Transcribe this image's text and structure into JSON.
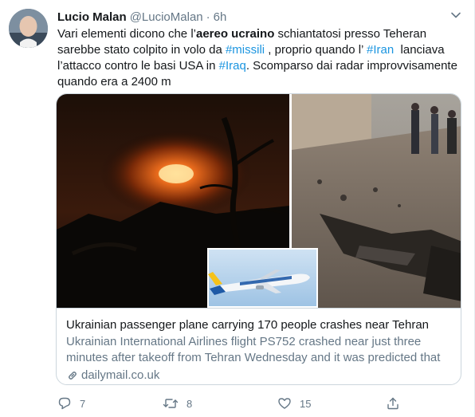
{
  "tweet": {
    "author_name": "Lucio Malan",
    "author_handle": "@LucioMalan",
    "separator": "·",
    "time": "6h",
    "text": {
      "l1_a": "Vari elementi dicono che l’",
      "l1_b": "aereo ucraino",
      "l1_c": " schiantatosi presso Teheran",
      "l2_a": "sarebbe stato colpito in volo da ",
      "l2_b": "#missili",
      "l2_c": " , proprio quando l’ ",
      "l2_d": "#Iran",
      "l2_e": "  lanciava",
      "l3_a": "l’attacco contro le basi USA in ",
      "l3_b": "#Iraq",
      "l3_c": ". Scomparso dai radar improvvisamente",
      "l4": "quando era a 2400 m"
    }
  },
  "card": {
    "title": "Ukrainian passenger plane carrying 170 people crashes near Tehran",
    "description": "Ukrainian International Airlines flight PS752 crashed near just three minutes after takeoff from Tehran Wednesday and it was predicted that ...",
    "domain": "dailymail.co.uk"
  },
  "actions": {
    "reply_count": "7",
    "retweet_count": "8",
    "like_count": "15"
  },
  "icons": {
    "caret": "chevron-down-icon",
    "reply": "reply-icon",
    "retweet": "retweet-icon",
    "like": "heart-icon",
    "share": "share-icon",
    "link": "link-icon"
  },
  "colors": {
    "link": "#1b95e0",
    "secondary_text": "#657786",
    "border": "#ccd6dd"
  }
}
